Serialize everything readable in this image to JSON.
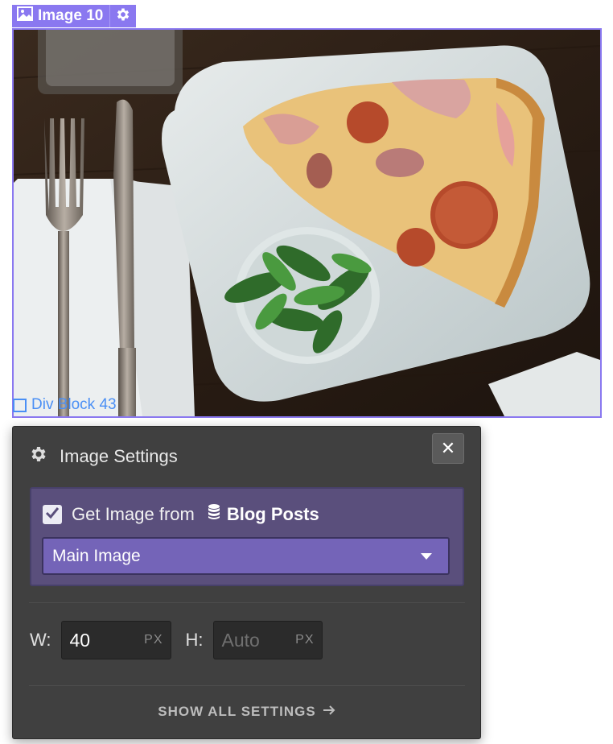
{
  "element_badge": {
    "label": "Image 10",
    "image_icon": "image-icon",
    "settings_icon": "gear-icon"
  },
  "canvas": {
    "inner_label": "Div Block 43",
    "accent_color": "#8a78f0",
    "inner_label_color": "#4a8ff5"
  },
  "panel": {
    "title": "Image Settings",
    "title_icon": "gear-icon",
    "close_icon": "close-icon",
    "cms": {
      "checked": true,
      "label": "Get Image from",
      "source_icon": "database-icon",
      "source_name": "Blog Posts",
      "field_selected": "Main Image"
    },
    "width": {
      "label": "W:",
      "value": "40",
      "unit": "PX"
    },
    "height": {
      "label": "H:",
      "placeholder": "Auto",
      "unit": "PX"
    },
    "show_all": "SHOW ALL SETTINGS",
    "colors": {
      "panel_bg": "#404040",
      "cms_bg": "#5a4f7c",
      "select_bg": "#7464b8"
    }
  }
}
